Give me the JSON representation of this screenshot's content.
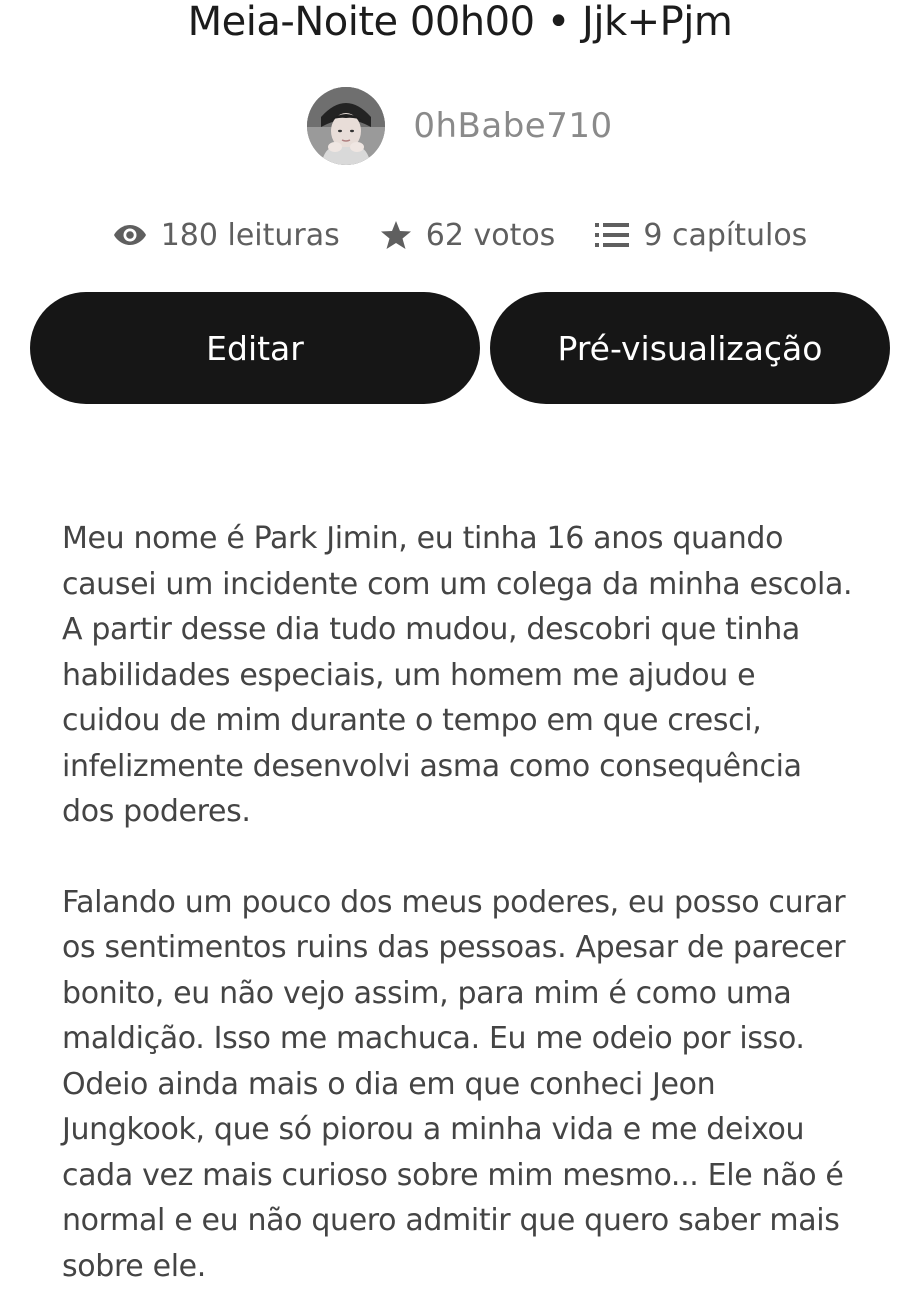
{
  "story": {
    "title": "Meia-Noite 00h00 • Jjk+Pjm",
    "author": "0hBabe710"
  },
  "stats": {
    "reads": "180 leituras",
    "votes": "62 votos",
    "chapters": "9 capítulos",
    "reads_icon": "eye-icon",
    "votes_icon": "star-icon",
    "chapters_icon": "list-icon"
  },
  "actions": {
    "edit_label": "Editar",
    "preview_label": "Pré-visualização"
  },
  "description": {
    "paragraphs": [
      "Meu nome é Park Jimin, eu tinha 16 anos quando causei um incidente com um colega da minha escola. A partir desse dia tudo mudou, descobri que tinha habilidades especiais, um homem me ajudou e cuidou de mim durante o tempo em que cresci, infelizmente desenvolvi asma como consequência dos poderes.",
      "Falando um pouco dos meus poderes, eu posso curar os sentimentos ruins das pessoas. Apesar de parecer bonito, eu não vejo assim, para mim é como uma maldição. Isso me machuca. Eu me odeio por isso. Odeio ainda mais o dia em que conheci Jeon Jungkook, que só piorou a minha vida e me deixou cada vez mais curioso sobre mim mesmo... Ele não é normal e eu não quero admitir que quero saber mais sobre ele."
    ]
  },
  "colors": {
    "button_bg": "#161616",
    "button_text": "#ffffff",
    "muted_text": "#8a8a8a",
    "stat_text": "#5f5f5f",
    "body_text": "#444444"
  }
}
